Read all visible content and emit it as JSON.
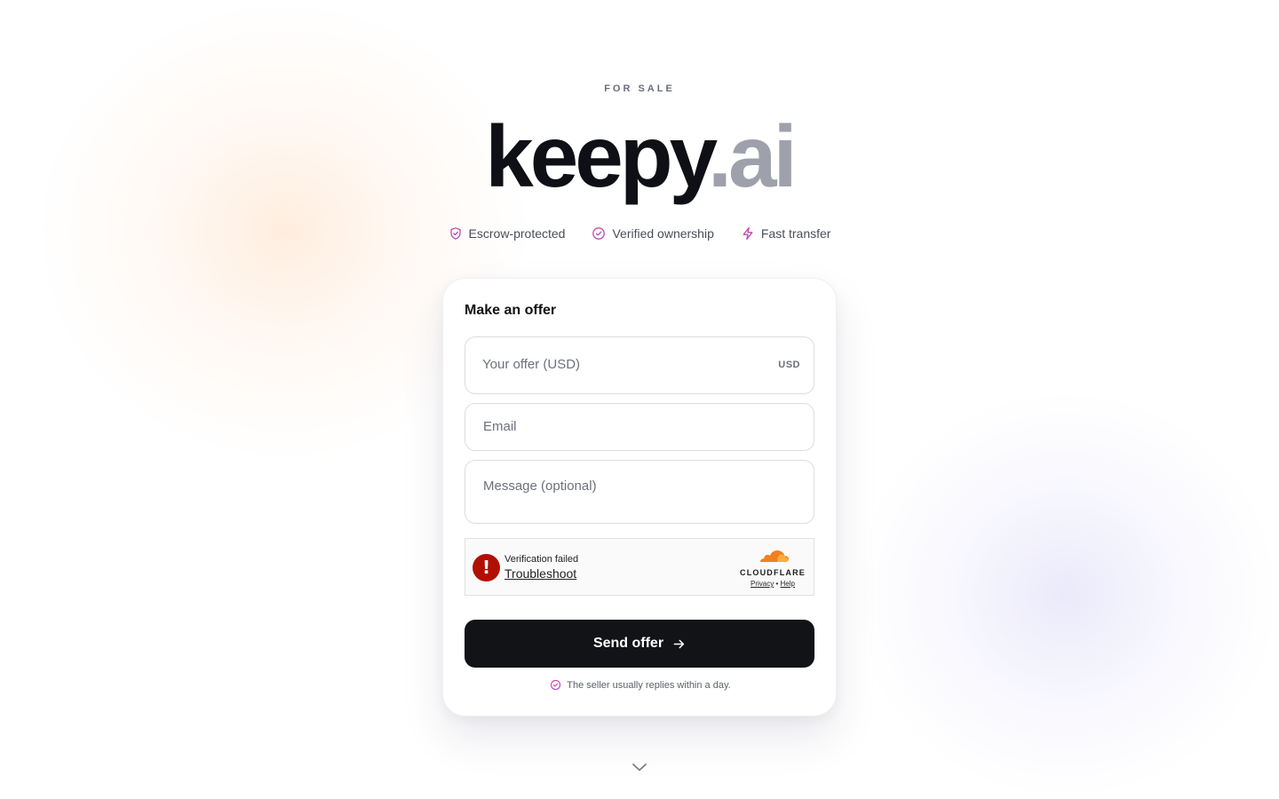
{
  "hero": {
    "eyebrow": "FOR SALE",
    "domain_name": "keepy",
    "domain_tld": ".ai"
  },
  "features": [
    {
      "icon": "shield-icon",
      "label": "Escrow-protected"
    },
    {
      "icon": "check-circle-icon",
      "label": "Verified ownership"
    },
    {
      "icon": "lightning-icon",
      "label": "Fast transfer"
    }
  ],
  "offer_form": {
    "title": "Make an offer",
    "offer_placeholder": "Your offer (USD)",
    "offer_value": "",
    "currency": "USD",
    "email_placeholder": "Email",
    "email_value": "",
    "message_placeholder": "Message (optional)",
    "message_value": "",
    "submit_label": "Send offer",
    "reply_note": "The seller usually replies within a day."
  },
  "captcha": {
    "status": "Verification failed",
    "action": "Troubleshoot",
    "brand": "CLOUDFLARE",
    "privacy": "Privacy",
    "separator": "•",
    "help": "Help"
  },
  "colors": {
    "accent_icon": "#d23a8a",
    "button_bg": "#121317",
    "error_red": "#b20f03",
    "cloudflare_orange": "#f38020"
  }
}
